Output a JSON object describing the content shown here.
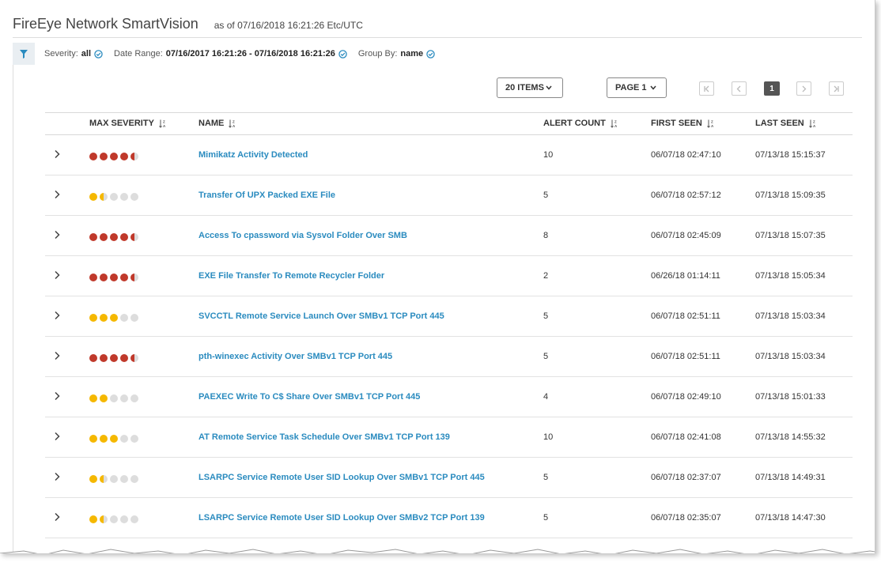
{
  "app": {
    "title": "FireEye Network SmartVision",
    "as_of": "as of 07/16/2018 16:21:26 Etc/UTC"
  },
  "filters": {
    "severity_label": "Severity:",
    "severity_value": "all",
    "date_label": "Date Range:",
    "date_value": "07/16/2017 16:21:26 - 07/16/2018 16:21:26",
    "group_label": "Group By:",
    "group_value": "name"
  },
  "pagination": {
    "items_label": "20 ITEMS",
    "page_label": "PAGE 1",
    "current_page": "1"
  },
  "table": {
    "headers": {
      "severity": "MAX SEVERITY",
      "name": "NAME",
      "count": "ALERT COUNT",
      "first": "FIRST SEEN",
      "last": "LAST SEEN"
    },
    "rows": [
      {
        "severity": [
          "red",
          "red",
          "red",
          "red",
          "half-red"
        ],
        "name": "Mimikatz Activity Detected",
        "count": "10",
        "first": "06/07/18 02:47:10",
        "last": "07/13/18 15:15:37"
      },
      {
        "severity": [
          "yellow",
          "half-yellow",
          "grey",
          "grey",
          "grey"
        ],
        "name": "Transfer Of UPX Packed EXE File",
        "count": "5",
        "first": "06/07/18 02:57:12",
        "last": "07/13/18 15:09:35"
      },
      {
        "severity": [
          "red",
          "red",
          "red",
          "red",
          "half-red"
        ],
        "name": "Access To cpassword via Sysvol Folder Over SMB",
        "count": "8",
        "first": "06/07/18 02:45:09",
        "last": "07/13/18 15:07:35"
      },
      {
        "severity": [
          "red",
          "red",
          "red",
          "red",
          "half-red"
        ],
        "name": "EXE File Transfer To Remote Recycler Folder",
        "count": "2",
        "first": "06/26/18 01:14:11",
        "last": "07/13/18 15:05:34"
      },
      {
        "severity": [
          "yellow",
          "yellow",
          "yellow",
          "grey",
          "grey"
        ],
        "name": "SVCCTL Remote Service Launch Over SMBv1 TCP Port 445",
        "count": "5",
        "first": "06/07/18 02:51:11",
        "last": "07/13/18 15:03:34"
      },
      {
        "severity": [
          "red",
          "red",
          "red",
          "red",
          "half-red"
        ],
        "name": "pth-winexec Activity Over SMBv1 TCP Port 445",
        "count": "5",
        "first": "06/07/18 02:51:11",
        "last": "07/13/18 15:03:34"
      },
      {
        "severity": [
          "yellow",
          "yellow",
          "grey",
          "grey",
          "grey"
        ],
        "name": "PAEXEC Write To C$ Share Over SMBv1 TCP Port 445",
        "count": "4",
        "first": "06/07/18 02:49:10",
        "last": "07/13/18 15:01:33"
      },
      {
        "severity": [
          "yellow",
          "yellow",
          "yellow",
          "grey",
          "grey"
        ],
        "name": "AT Remote Service Task Schedule Over SMBv1 TCP Port 139",
        "count": "10",
        "first": "06/07/18 02:41:08",
        "last": "07/13/18 14:55:32"
      },
      {
        "severity": [
          "yellow",
          "half-yellow",
          "grey",
          "grey",
          "grey"
        ],
        "name": "LSARPC Service Remote User SID Lookup Over SMBv1 TCP Port 445",
        "count": "5",
        "first": "06/07/18 02:37:07",
        "last": "07/13/18 14:49:31"
      },
      {
        "severity": [
          "yellow",
          "half-yellow",
          "grey",
          "grey",
          "grey"
        ],
        "name": "LSARPC Service Remote User SID Lookup Over SMBv2 TCP Port 139",
        "count": "5",
        "first": "06/07/18 02:35:07",
        "last": "07/13/18 14:47:30"
      }
    ]
  },
  "colors": {
    "accent": "#2a8bbf",
    "severity_high": "#c0392b",
    "severity_medium": "#f5b800",
    "severity_off": "#dddddd"
  },
  "icons": {
    "filter": "filter-icon",
    "check": "check-circle-icon",
    "sort": "sort-az-icon",
    "chevron": "chevron-right-icon",
    "first": "first-page-icon",
    "prev": "prev-page-icon",
    "next": "next-page-icon",
    "last": "last-page-icon"
  }
}
